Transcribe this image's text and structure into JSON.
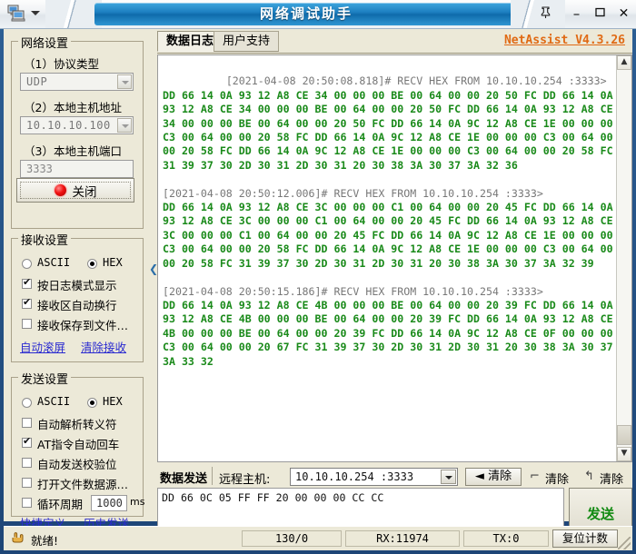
{
  "window": {
    "title": "网络调试助手",
    "sysicon": "computer-icon",
    "pin": "📌",
    "minimize": "–",
    "maximize": "❐",
    "close": "✕"
  },
  "left_panel": {
    "network": {
      "title": "网络设置",
      "protocol_label": "（1）协议类型",
      "protocol_value": "UDP",
      "host_label": "（2）本地主机地址",
      "host_value": "10.10.10.100",
      "port_label": "（3）本地主机端口",
      "port_value": "3333",
      "connect_button": "关闭"
    },
    "receive": {
      "title": "接收设置",
      "ascii_label": "ASCII",
      "hex_label": "HEX",
      "ascii_checked": false,
      "hex_checked": true,
      "opt_log_mode": "按日志模式显示",
      "opt_log_mode_checked": true,
      "opt_auto_wrap": "接收区自动换行",
      "opt_auto_wrap_checked": true,
      "opt_save_file": "接收保存到文件…",
      "opt_save_file_checked": false,
      "link_autoscroll": "自动滚屏",
      "link_clear": "清除接收"
    },
    "send": {
      "title": "发送设置",
      "ascii_label": "ASCII",
      "hex_label": "HEX",
      "ascii_checked": false,
      "hex_checked": true,
      "opt_escape": "自动解析转义符",
      "opt_escape_checked": false,
      "opt_at_cr": "AT指令自动回车",
      "opt_at_cr_checked": true,
      "opt_checksum": "自动发送校验位",
      "opt_checksum_checked": false,
      "opt_file_src": "打开文件数据源…",
      "opt_file_src_checked": false,
      "opt_loop": "循环周期",
      "opt_loop_checked": false,
      "loop_value": "1000",
      "loop_unit": "ms",
      "link_shortcut": "快捷定义",
      "link_history": "历史发送"
    }
  },
  "splitter": {
    "collapse_arrow": "❮"
  },
  "right_panel": {
    "tabs": [
      {
        "label": "数据日志",
        "selected": true
      },
      {
        "label": "用户支持",
        "selected": false
      }
    ],
    "brand": "NetAssist V4.3.26",
    "log_blocks": [
      {
        "header": "[2021-04-08 20:50:08.818]# RECV HEX FROM 10.10.10.254 :3333>",
        "lines": [
          "DD 66 14 0A 93 12 A8 CE 34 00 00 00 BE 00 64 00 00 20 50 FC DD 66 14 0A",
          "93 12 A8 CE 34 00 00 00 BE 00 64 00 00 20 50 FC DD 66 14 0A 93 12 A8 CE",
          "34 00 00 00 BE 00 64 00 00 20 50 FC DD 66 14 0A 9C 12 A8 CE 1E 00 00 00",
          "C3 00 64 00 00 20 58 FC DD 66 14 0A 9C 12 A8 CE 1E 00 00 00 C3 00 64 00",
          "00 20 58 FC DD 66 14 0A 9C 12 A8 CE 1E 00 00 00 C3 00 64 00 00 20 58 FC",
          "31 39 37 30 2D 30 31 2D 30 31 20 30 38 3A 30 37 3A 32 36"
        ]
      },
      {
        "header": "[2021-04-08 20:50:12.006]# RECV HEX FROM 10.10.10.254 :3333>",
        "lines": [
          "DD 66 14 0A 93 12 A8 CE 3C 00 00 00 C1 00 64 00 00 20 45 FC DD 66 14 0A",
          "93 12 A8 CE 3C 00 00 00 C1 00 64 00 00 20 45 FC DD 66 14 0A 93 12 A8 CE",
          "3C 00 00 00 C1 00 64 00 00 20 45 FC DD 66 14 0A 9C 12 A8 CE 1E 00 00 00",
          "C3 00 64 00 00 20 58 FC DD 66 14 0A 9C 12 A8 CE 1E 00 00 00 C3 00 64 00",
          "00 20 58 FC 31 39 37 30 2D 30 31 2D 30 31 20 30 38 3A 30 37 3A 32 39"
        ]
      },
      {
        "header": "[2021-04-08 20:50:15.186]# RECV HEX FROM 10.10.10.254 :3333>",
        "lines": [
          "DD 66 14 0A 93 12 A8 CE 4B 00 00 00 BE 00 64 00 00 20 39 FC DD 66 14 0A",
          "93 12 A8 CE 4B 00 00 00 BE 00 64 00 00 20 39 FC DD 66 14 0A 93 12 A8 CE",
          "4B 00 00 00 BE 00 64 00 00 20 39 FC DD 66 14 0A 9C 12 A8 CE 0F 00 00 00",
          "C3 00 64 00 00 20 67 FC 31 39 37 30 2D 30 31 2D 30 31 20 30 38 3A 30 37",
          "3A 33 32"
        ]
      }
    ],
    "send_bar": {
      "label": "数据发送",
      "remote_label": "远程主机:",
      "remote_value": "10.10.10.254 :3333",
      "clear_button": "清除",
      "clear_button_icon": "◄",
      "clear_recv": "清除",
      "clear_recv_icon": "⌐",
      "clear_send": "清除",
      "clear_send_icon": "↰"
    },
    "send_input": "DD 66 0C 05 FF FF 20 00 00 00 CC CC",
    "send_button": "发送"
  },
  "status_bar": {
    "icon": "hand-icon",
    "ready": "就绪!",
    "counter": "130/0",
    "rx": "RX:11974",
    "tx": "TX:0",
    "reset_button": "复位计数"
  },
  "colors": {
    "title_blue": "#1d7fc0",
    "brand_orange": "#e06a14",
    "log_green": "#1a8a1a",
    "log_header_gray": "#777777",
    "link_blue": "#2a2ad0",
    "send_green": "#128a12",
    "scrollbar_orange": "#d07a28"
  }
}
